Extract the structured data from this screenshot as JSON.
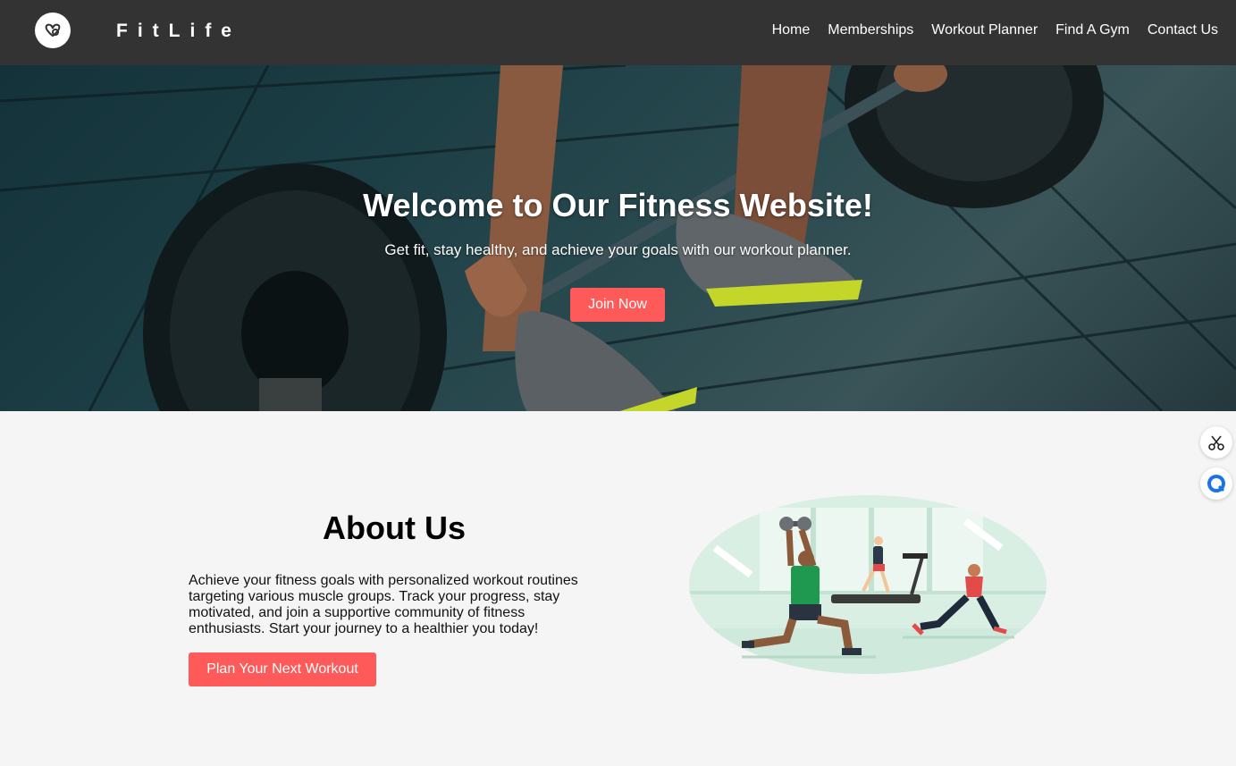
{
  "nav": {
    "brand": "FitLife",
    "links": [
      "Home",
      "Memberships",
      "Workout Planner",
      "Find A Gym",
      "Contact Us"
    ]
  },
  "hero": {
    "title": "Welcome to Our Fitness Website!",
    "subtitle": "Get fit, stay healthy, and achieve your goals with our workout planner.",
    "button_label": "Join Now"
  },
  "about": {
    "title": "About Us",
    "text": "Achieve your fitness goals with personalized workout routines targeting various muscle groups. Track your progress, stay motivated, and join a supportive community of fitness enthusiasts. Start your journey to a healthier you today!",
    "button_label": "Plan Your Next Workout"
  },
  "widgets": {
    "icons": [
      "scissors-icon",
      "chat-icon"
    ]
  },
  "colors": {
    "navbar": "#333333",
    "accent": "#ff5a5a",
    "page_bg": "#f5f5f5"
  }
}
